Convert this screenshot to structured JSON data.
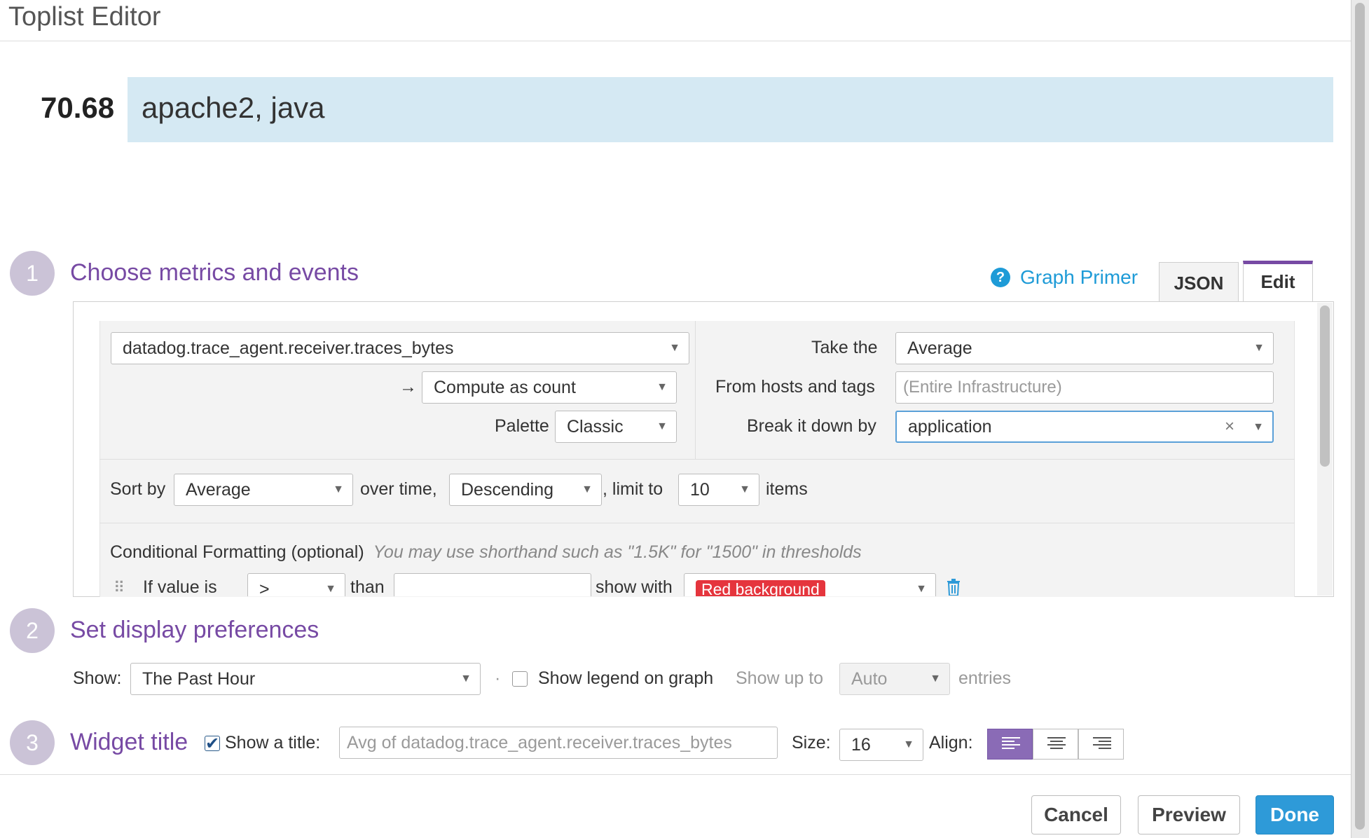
{
  "modal": {
    "title": "Toplist Editor"
  },
  "preview": {
    "value": "70.68",
    "label": "apache2, java"
  },
  "steps": [
    {
      "number": "1",
      "title": "Choose metrics and events"
    },
    {
      "number": "2",
      "title": "Set display preferences"
    },
    {
      "number": "3",
      "title": "Widget title"
    }
  ],
  "header_tools": {
    "help_icon": "question-circle-icon",
    "graph_primer": "Graph Primer",
    "tabs": [
      {
        "label": "JSON",
        "active": false
      },
      {
        "label": "Edit",
        "active": true
      }
    ]
  },
  "metric": {
    "name": "datadog.trace_agent.receiver.traces_bytes",
    "arrow": "→",
    "compute_as": "Compute as count",
    "palette_label": "Palette",
    "palette": "Classic",
    "take_the_label": "Take the",
    "take_the": "Average",
    "hosts_label": "From hosts and tags",
    "hosts_placeholder": "(Entire Infrastructure)",
    "breakdown_label": "Break it down by",
    "breakdown": "application",
    "clear_glyph": "×"
  },
  "sort": {
    "sort_by_label": "Sort by",
    "sort_by": "Average",
    "over_time_label": "over time,",
    "order": "Descending",
    "limit_label": ", limit to",
    "limit": "10",
    "items_label": "items"
  },
  "conditional": {
    "title": "Conditional Formatting (optional)",
    "note": "You may use shorthand such as \"1.5K\" for \"1500\" in thresholds",
    "drag_glyph": "⠿",
    "if_value_label": "If value is",
    "comparator": ">",
    "than_label": "than",
    "threshold_value": "",
    "show_with_label": "show with",
    "format": "Red background",
    "format_color": "#e5353d"
  },
  "display": {
    "show_label": "Show:",
    "timeframe": "The Past Hour",
    "bullet": "·",
    "legend_checked": false,
    "legend_label": "Show legend on graph",
    "show_up_to_label": "Show up to",
    "show_up_to": "Auto",
    "entries_label": "entries"
  },
  "widget_title": {
    "show_title_checked": true,
    "show_title_label": "Show a title:",
    "title_placeholder": "Avg of datadog.trace_agent.receiver.traces_bytes",
    "size_label": "Size:",
    "size": "16",
    "align_label": "Align:",
    "align_options": [
      "align-left-icon",
      "align-center-icon",
      "align-right-icon"
    ],
    "align_active": "left"
  },
  "footer": {
    "cancel": "Cancel",
    "preview": "Preview",
    "done": "Done"
  },
  "colors": {
    "accent_purple": "#774aa4",
    "primary_blue": "#2e9ad8",
    "preview_bar": "#d5e9f3"
  }
}
